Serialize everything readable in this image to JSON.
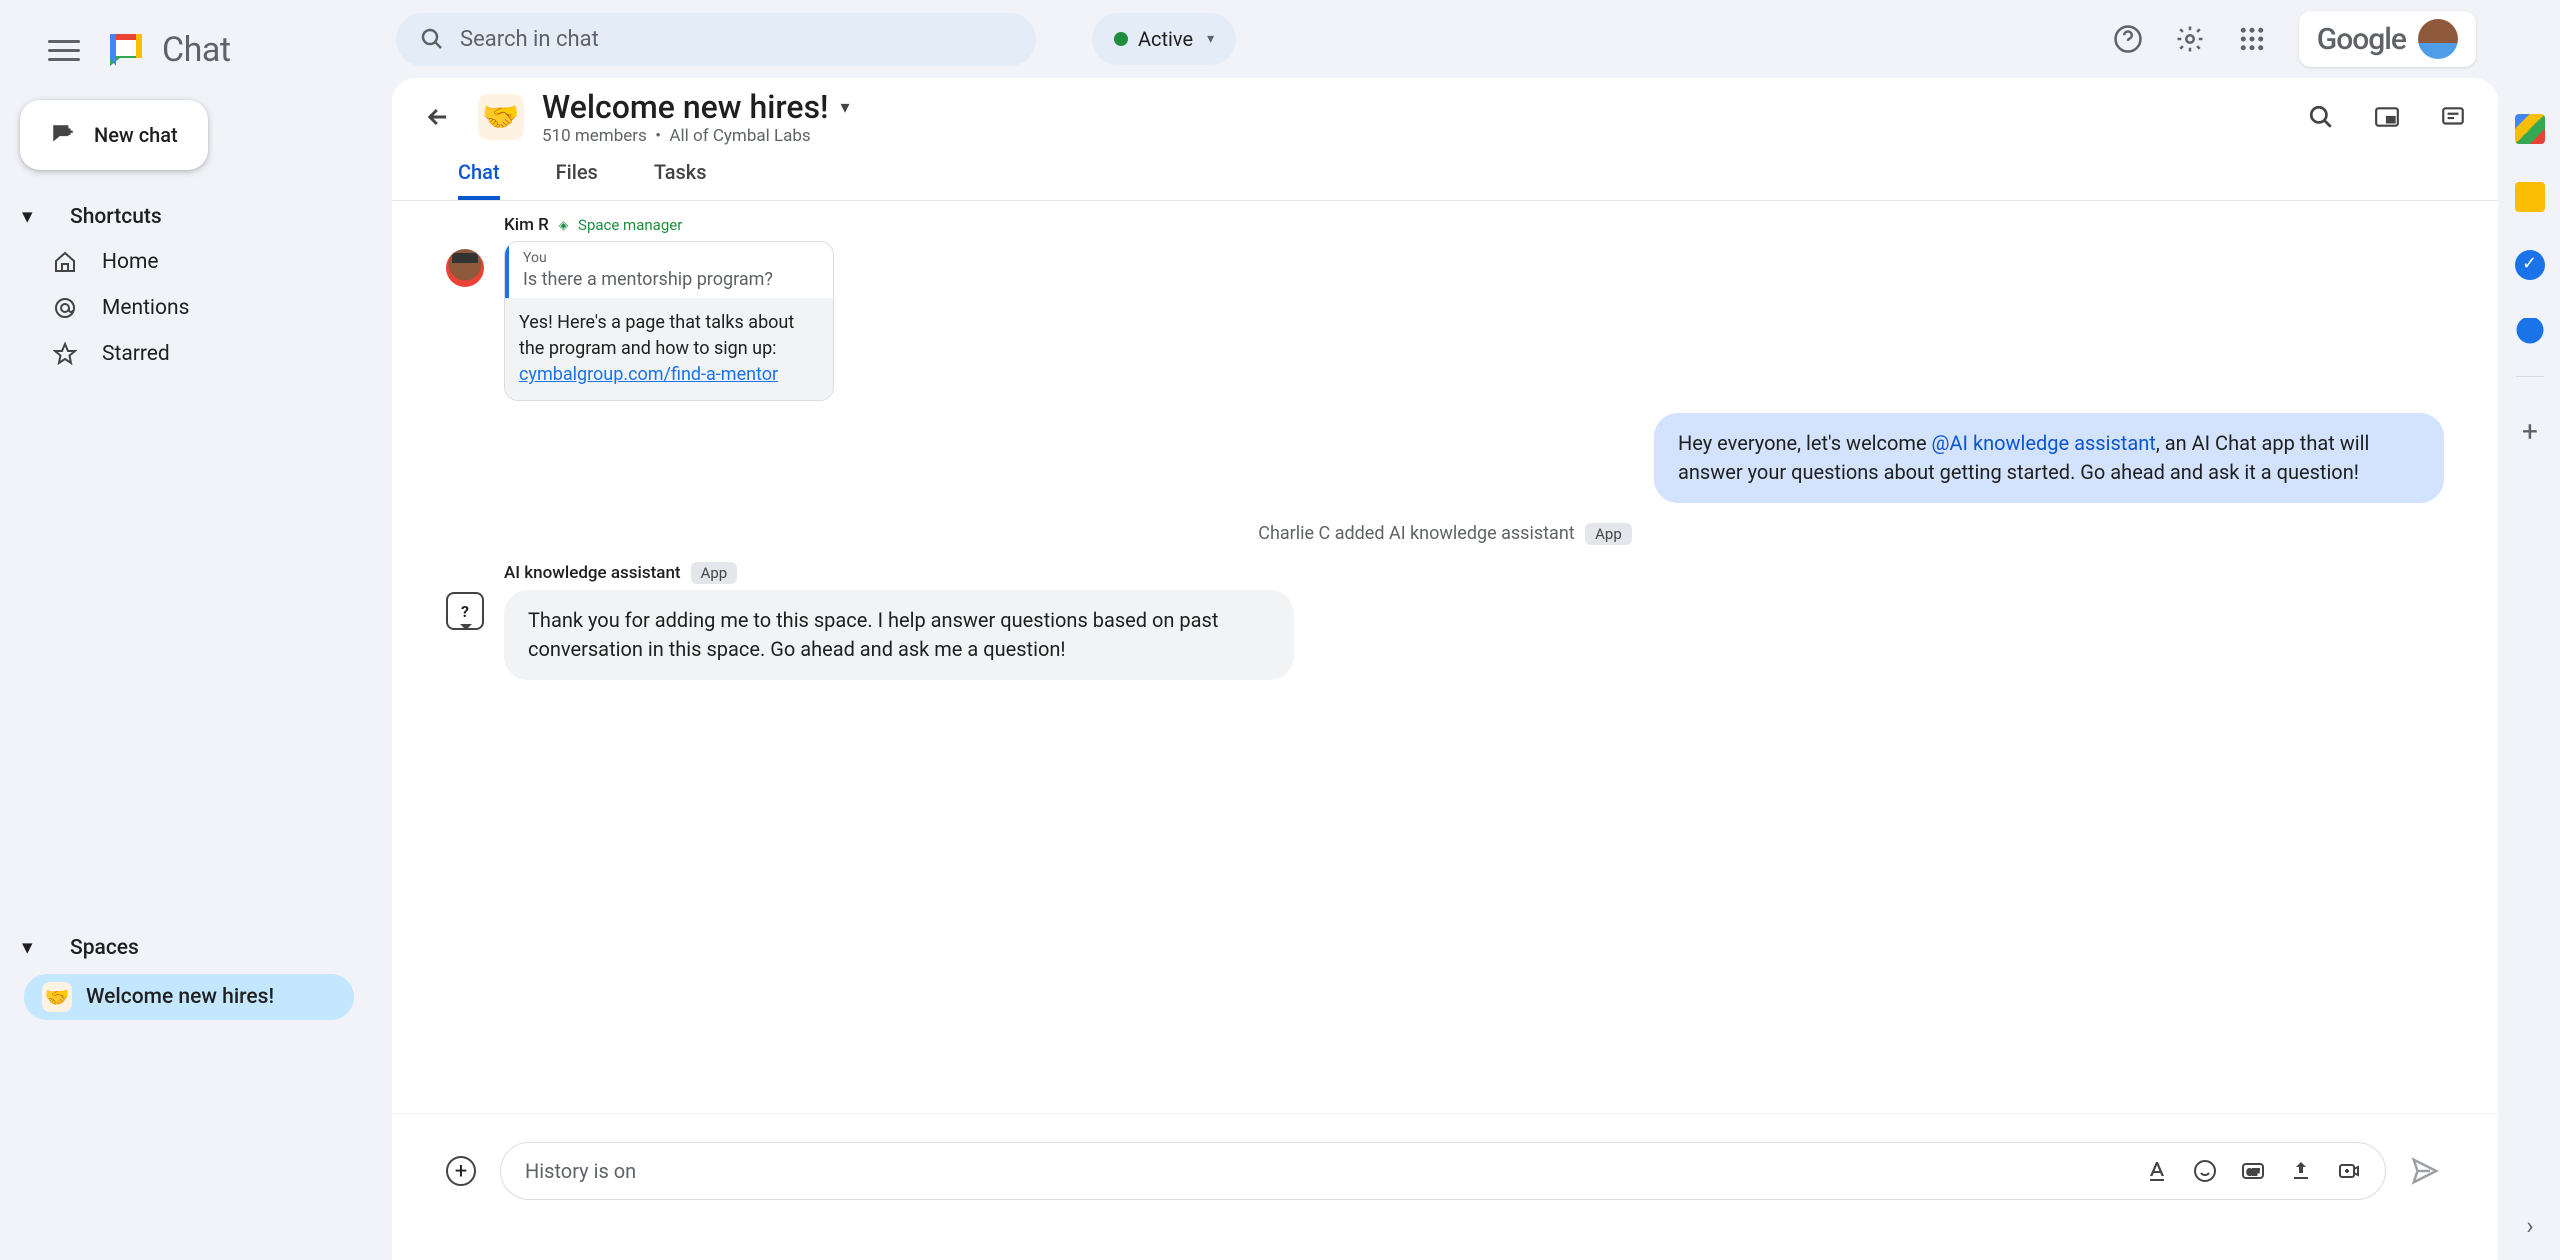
{
  "app": {
    "name": "Chat"
  },
  "search": {
    "placeholder": "Search in chat"
  },
  "presence": {
    "label": "Active"
  },
  "brand": {
    "text": "Google"
  },
  "newChat": {
    "label": "New chat"
  },
  "nav": {
    "shortcuts": "Shortcuts",
    "home": "Home",
    "mentions": "Mentions",
    "starred": "Starred"
  },
  "spaces": {
    "heading": "Spaces",
    "items": [
      {
        "emoji": "🤝",
        "name": "Welcome new hires!"
      }
    ]
  },
  "conversation": {
    "emoji": "🤝",
    "title": "Welcome new hires!",
    "members": "510 members",
    "scope": "All of Cymbal Labs",
    "tabs": {
      "chat": "Chat",
      "files": "Files",
      "tasks": "Tasks"
    }
  },
  "messages": {
    "kim": {
      "author": "Kim R",
      "role": "Space manager",
      "quote": {
        "youLabel": "You",
        "question": "Is there a mentorship program?",
        "answerPre": "Yes! Here's a page that talks about the program and how to sign up:",
        "link": "cymbalgroup.com/find-a-mentor"
      }
    },
    "welcome": {
      "pre": "Hey everyone, let's welcome ",
      "mention": "@AI knowledge assistant",
      "post": ", an AI Chat app that will answer your questions about getting started.  Go ahead and ask it a question!"
    },
    "system": {
      "text": "Charlie C added AI knowledge assistant",
      "badge": "App"
    },
    "ai": {
      "author": "AI knowledge assistant",
      "badge": "App",
      "body": "Thank you for adding me to this space. I help answer questions based on past conversation in this space. Go ahead and ask me a question!"
    }
  },
  "compose": {
    "placeholder": "History is on"
  }
}
